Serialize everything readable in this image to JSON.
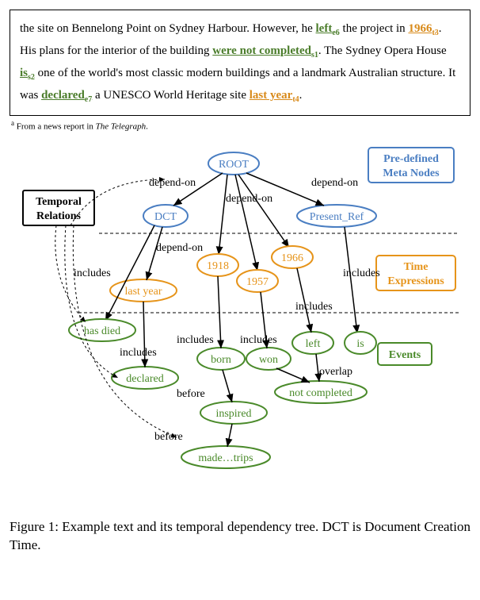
{
  "paragraph": {
    "pre": "the site on Bennelong Point on Sydney Harbour. However, he ",
    "left": "left",
    "left_sub": "e6",
    "mid1": " the project in ",
    "y1966": "1966",
    "y1966_sub": "t3",
    "mid2": ". His plans for the interior of the building ",
    "notcompleted": "were not completed",
    "notcompleted_sub": "s1",
    "mid3": ". The Sydney Opera House ",
    "is": "is",
    "is_sub": "s2",
    "mid4": " one of the world's most classic modern buildings and a landmark Australian structure. It was ",
    "declared": "declared",
    "declared_sub": "e7",
    "mid5": " a UNESCO World Heritage site ",
    "lastyear": "last year",
    "lastyear_sub": "t4",
    "post": "."
  },
  "footnote": {
    "marker": "a",
    "text": " From a news report in ",
    "source": "The Telegraph",
    "tail": "."
  },
  "diagram": {
    "meta_nodes": {
      "root": "ROOT",
      "dct": "DCT",
      "present": "Present_Ref"
    },
    "time_nodes": {
      "lastyear": "last year",
      "y1918": "1918",
      "y1957": "1957",
      "y1966": "1966"
    },
    "event_nodes": {
      "hasdied": "has died",
      "declared": "declared",
      "born": "born",
      "won": "won",
      "left": "left",
      "is": "is",
      "inspired": "inspired",
      "notcompleted": "not completed",
      "madetrips": "made…trips"
    },
    "edge_labels": {
      "dependon": "depend-on",
      "includes": "includes",
      "before": "before",
      "overlap": "overlap"
    },
    "legends": {
      "temporal": [
        "Temporal",
        "Relations"
      ],
      "meta": [
        "Pre-defined",
        "Meta Nodes"
      ],
      "time": [
        "Time",
        "Expressions"
      ],
      "events": "Events"
    }
  },
  "caption": {
    "text": "Figure 1: Example text and its temporal dependency tree. DCT is Document Creation Time."
  }
}
